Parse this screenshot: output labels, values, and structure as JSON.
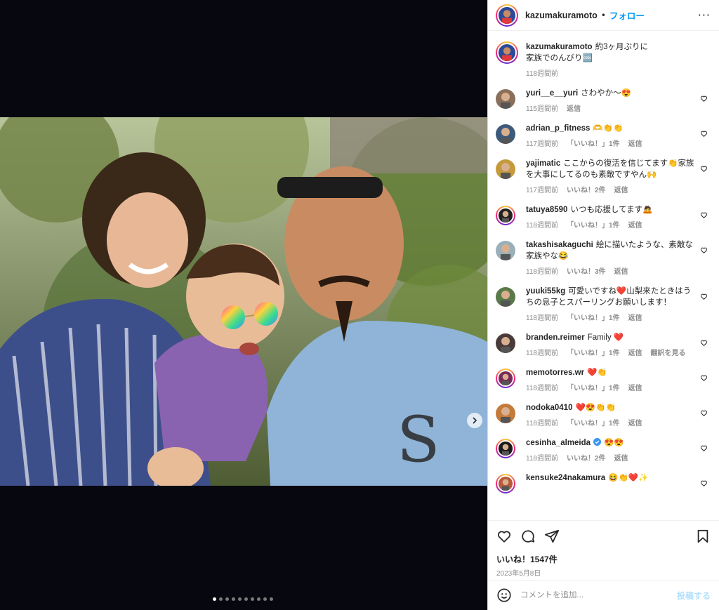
{
  "header": {
    "username": "kazumakuramoto",
    "separator": "•",
    "follow_label": "フォロー",
    "more_label": "···"
  },
  "caption": {
    "username": "kazumakuramoto",
    "text": "約3ヶ月ぶりに\n家族でのんびり🆒",
    "time": "118週間前"
  },
  "comments": [
    {
      "username": "yuri__e__yuri",
      "text": "さわやか〜😍",
      "time": "115週間前",
      "likes": "",
      "reply": "返信",
      "translate": ""
    },
    {
      "username": "adrian_p_fitness",
      "text": "🫶👏👏",
      "time": "117週間前",
      "likes": "「いいね！」1件",
      "reply": "返信",
      "translate": ""
    },
    {
      "username": "yajimatic",
      "text": "ここからの復活を信じてます👏家族を大事にしてるのも素敵ですやん🙌",
      "time": "117週間前",
      "likes": "いいね！2件",
      "reply": "返信",
      "translate": ""
    },
    {
      "username": "tatuya8590",
      "text": "いつも応援してます🙇",
      "time": "118週間前",
      "likes": "「いいね！」1件",
      "reply": "返信",
      "translate": ""
    },
    {
      "username": "takashisakaguchi",
      "text": "絵に描いたような、素敵な家族やな😂",
      "time": "118週間前",
      "likes": "いいね！3件",
      "reply": "返信",
      "translate": ""
    },
    {
      "username": "yuuki55kg",
      "text": "可愛いですね❤️山梨来たときはうちの息子とスパーリングお願いします！",
      "time": "118週間前",
      "likes": "「いいね！」1件",
      "reply": "返信",
      "translate": ""
    },
    {
      "username": "branden.reimer",
      "text": "Family ❤️",
      "time": "118週間前",
      "likes": "「いいね！」1件",
      "reply": "返信",
      "translate": "翻訳を見る"
    },
    {
      "username": "memotorres.wr",
      "text": "❤️👏",
      "time": "118週間前",
      "likes": "「いいね！」1件",
      "reply": "返信",
      "translate": ""
    },
    {
      "username": "nodoka0410",
      "text": "❤️😍👏👏",
      "time": "118週間前",
      "likes": "「いいね！」1件",
      "reply": "返信",
      "translate": ""
    },
    {
      "username": "cesinha_almeida",
      "text": "😍😍",
      "time": "118週間前",
      "likes": "いいね！2件",
      "reply": "返信",
      "translate": ""
    },
    {
      "username": "kensuke24nakamura",
      "text": "😆👏❤️✨",
      "time": "",
      "likes": "",
      "reply": "",
      "translate": ""
    }
  ],
  "actions": {
    "likes_count": "いいね！1547件",
    "date": "2023年5月8日"
  },
  "composer": {
    "placeholder": "コメントを追加...",
    "post_label": "投稿する"
  },
  "media": {
    "slide_count": 10,
    "active_slide": 1
  },
  "colors": {
    "accent": "#0095f6",
    "verified": "#3897f0"
  }
}
